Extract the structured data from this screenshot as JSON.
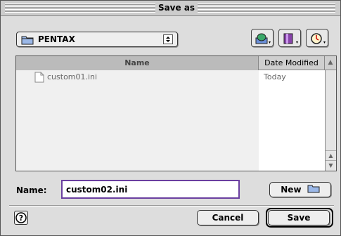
{
  "window": {
    "title": "Save as"
  },
  "location": {
    "label": "PENTAX",
    "arrows_glyph": "⬍"
  },
  "toolbar": {
    "buttons": [
      {
        "icon": "shortcuts-icon"
      },
      {
        "icon": "favorites-icon"
      },
      {
        "icon": "recent-icon"
      }
    ]
  },
  "list": {
    "columns": {
      "name": "Name",
      "date": "Date Modified",
      "sort_glyph": "▲"
    },
    "rows": [
      {
        "name": "custom01.ini",
        "date": "Today"
      }
    ],
    "scroll_up_glyph": "▲",
    "scroll_down_glyph": "▼"
  },
  "name_field": {
    "label": "Name:",
    "value": "custom02.ini"
  },
  "buttons": {
    "new": "New",
    "cancel": "Cancel",
    "save": "Save",
    "help": "?"
  },
  "colors": {
    "focus_ring": "#6a3fa0"
  }
}
